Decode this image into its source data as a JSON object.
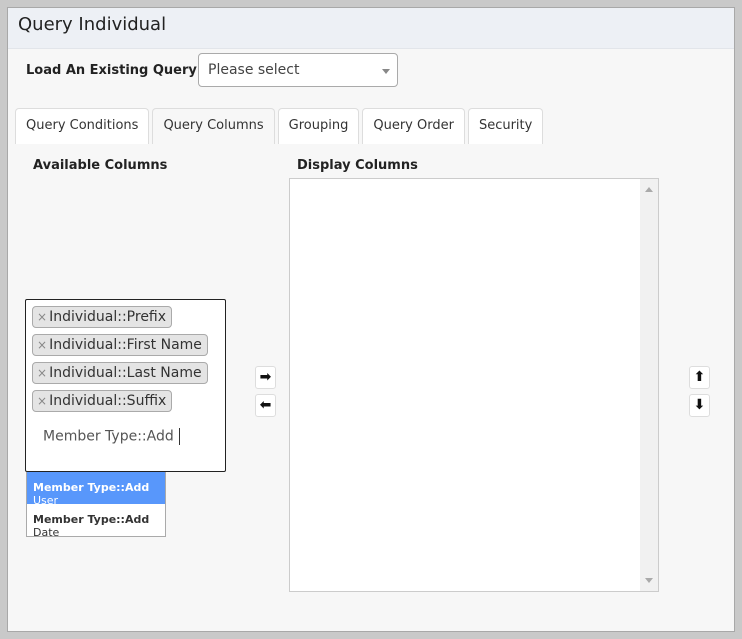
{
  "title": "Query Individual",
  "load_query": {
    "label": "Load An Existing Query:",
    "placeholder": "Please select"
  },
  "tabs": [
    {
      "label": "Query Conditions"
    },
    {
      "label": "Query Columns",
      "active": true
    },
    {
      "label": "Grouping"
    },
    {
      "label": "Query Order"
    },
    {
      "label": "Security"
    }
  ],
  "available": {
    "heading": "Available Columns",
    "selected": [
      "Individual::Prefix",
      "Individual::First Name",
      "Individual::Last Name",
      "Individual::Suffix"
    ],
    "typed": "Member Type::Add",
    "suggestions": [
      {
        "bold": "Member Type::Add",
        "rest": " User",
        "highlighted": true
      },
      {
        "bold": "Member Type::Add",
        "rest": " Date"
      }
    ]
  },
  "display": {
    "heading": "Display Columns",
    "items": []
  },
  "icons": {
    "add": "arrow-right-icon",
    "remove": "arrow-left-icon",
    "up": "arrow-up-icon",
    "down": "arrow-down-icon",
    "remove_chip": "×"
  },
  "colors": {
    "highlight": "#5897fb",
    "header_bg": "#edf0f5"
  }
}
